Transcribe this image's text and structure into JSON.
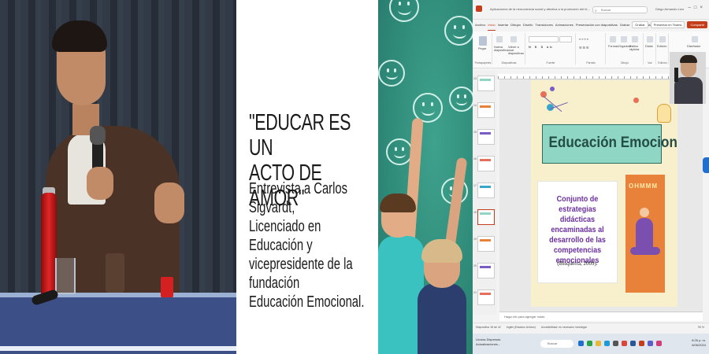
{
  "panel2": {
    "headline_line1": "\"EDUCAR ES UN",
    "headline_line2": "ACTO DE AMOR\"",
    "sub_line1": "Entrevista a Carlos Sigvardt,",
    "sub_line2": "Licenciado en Educación y",
    "sub_line3": "vicepresidente de la fundación",
    "sub_line4": "Educación Emocional."
  },
  "ppt": {
    "window_title": "Aplicaciones de la neurociencia social y afectiva a la promoción del bienestar en contextos educativos... • Guardado en Este PC",
    "search_placeholder": "Buscar",
    "user": "Diego Armando Leon Rodriguez",
    "menu": [
      "Archivo",
      "Inicio",
      "Insertar",
      "Dibujar",
      "Diseño",
      "Transiciones",
      "Animaciones",
      "Presentación con diapositivas",
      "Grabar",
      "Revisar",
      "Vista",
      "Ayuda"
    ],
    "active_menu": "Inicio",
    "toolbar_buttons": {
      "record": "Grabar",
      "present": "Presentar en Teams",
      "share": "Compartir"
    },
    "ribbon_groups": {
      "clipboard": "Portapapeles",
      "slides": "Diapositivas",
      "font": "Fuente",
      "paragraph": "Párrafo",
      "drawing": "Dibujo",
      "voice": "Voz",
      "editing": "Edición",
      "designer": "Diseñador"
    },
    "ribbon_items": {
      "paste": "Pegar",
      "new_slide": "Nueva diapositiva",
      "reuse": "Volver a usar diapositivas",
      "shapes": "Formas",
      "arrange": "Organizar",
      "quick_styles": "Estilos rápidos",
      "dictate": "Dictar",
      "editing": "Edición",
      "designer": "Diseñador"
    },
    "slide": {
      "title": "Educación Emocional",
      "card_text": "Conjunto de estrategias didácticas encaminadas al desarrollo de las competencias emocionales",
      "citation": "(Bisquerra, 2009).",
      "image_text": "OHMMM"
    },
    "thumb_numbers": [
      "13",
      "14",
      "15",
      "16",
      "17",
      "18",
      "19",
      "20",
      "21"
    ],
    "notes_placeholder": "Haga clic para agregar notas",
    "status": {
      "slide_info": "Diapositiva 18 de 42",
      "language": "Inglés (Estados Unidos)",
      "accessibility": "Accesibilidad: es necesario investigar",
      "zoom": "99 %"
    },
    "taskbar": {
      "weather_line1": "Lluvias Dispersas",
      "weather_line2": "Actualizaciones...",
      "search": "Buscar",
      "time": "8:26 p. m.",
      "date": "6/06/2024"
    },
    "colors": {
      "accent": "#c43e1c",
      "slide_title_bg": "#8fd6c5",
      "slide_text": "#6b2f9f",
      "slide_bg": "#f8f0cc"
    }
  }
}
